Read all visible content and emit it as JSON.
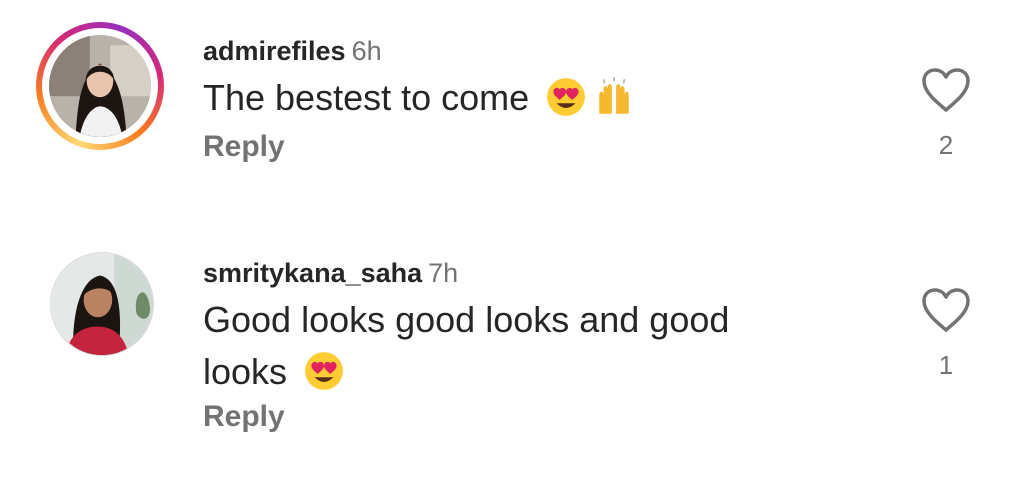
{
  "comments": [
    {
      "username": "admirefiles",
      "time": "6h",
      "text": "The bestest to come",
      "emojis": [
        "heart-eyes-emoji",
        "raising-hands-emoji"
      ],
      "reply_label": "Reply",
      "like_count": "2",
      "has_story_ring": true
    },
    {
      "username": "smritykana_saha",
      "time": "7h",
      "text": "Good looks good looks and good looks",
      "emojis": [
        "heart-eyes-emoji"
      ],
      "reply_label": "Reply",
      "like_count": "1",
      "has_story_ring": false
    }
  ],
  "colors": {
    "text_primary": "#262626",
    "text_secondary": "#737373",
    "story_ring": [
      "#feda75",
      "#fa7e1e",
      "#d62976",
      "#962fbf"
    ]
  }
}
